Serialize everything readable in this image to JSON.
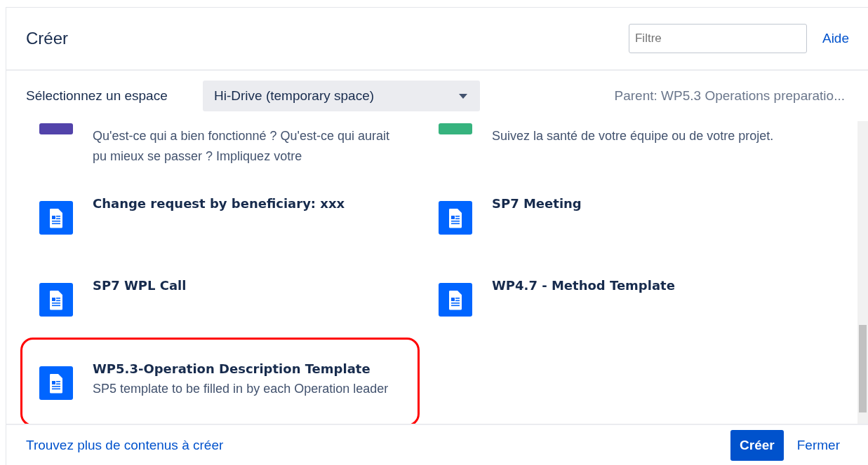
{
  "dialog": {
    "title": "Créer",
    "filter": {
      "placeholder": "Filtre"
    },
    "help_link": "Aide"
  },
  "space_bar": {
    "label": "Sélectionnez un espace",
    "space": "Hi-Drive (temporary space)",
    "parent": "Parent: WP5.3 Operations preparatio..."
  },
  "templates": [
    {
      "kind": "bar",
      "color": "#5243aa",
      "description": "Qu'est-ce qui a bien fonctionné ? Qu'est-ce qui aurait pu mieux se passer ? Impliquez votre",
      "highlighted": false
    },
    {
      "kind": "bar",
      "color": "#36b37e",
      "description": "Suivez la santé de votre équipe ou de votre projet.",
      "highlighted": false
    },
    {
      "kind": "page",
      "title": "Change request by beneficiary: xxx",
      "highlighted": false
    },
    {
      "kind": "page",
      "title": "SP7 Meeting",
      "highlighted": false
    },
    {
      "kind": "page",
      "title": "SP7 WPL Call",
      "highlighted": false
    },
    {
      "kind": "page",
      "title": "WP4.7 - Method Template",
      "highlighted": false
    },
    {
      "kind": "page",
      "title": "WP5.3-Operation Description Template",
      "description": "SP5 template to be filled in by each Operation leader",
      "highlighted": true
    }
  ],
  "footer": {
    "more_link": "Trouvez plus de contenus à créer",
    "buttons": [
      {
        "label": "Créer",
        "kind": "primary"
      },
      {
        "label": "Fermer",
        "kind": "link"
      }
    ]
  }
}
